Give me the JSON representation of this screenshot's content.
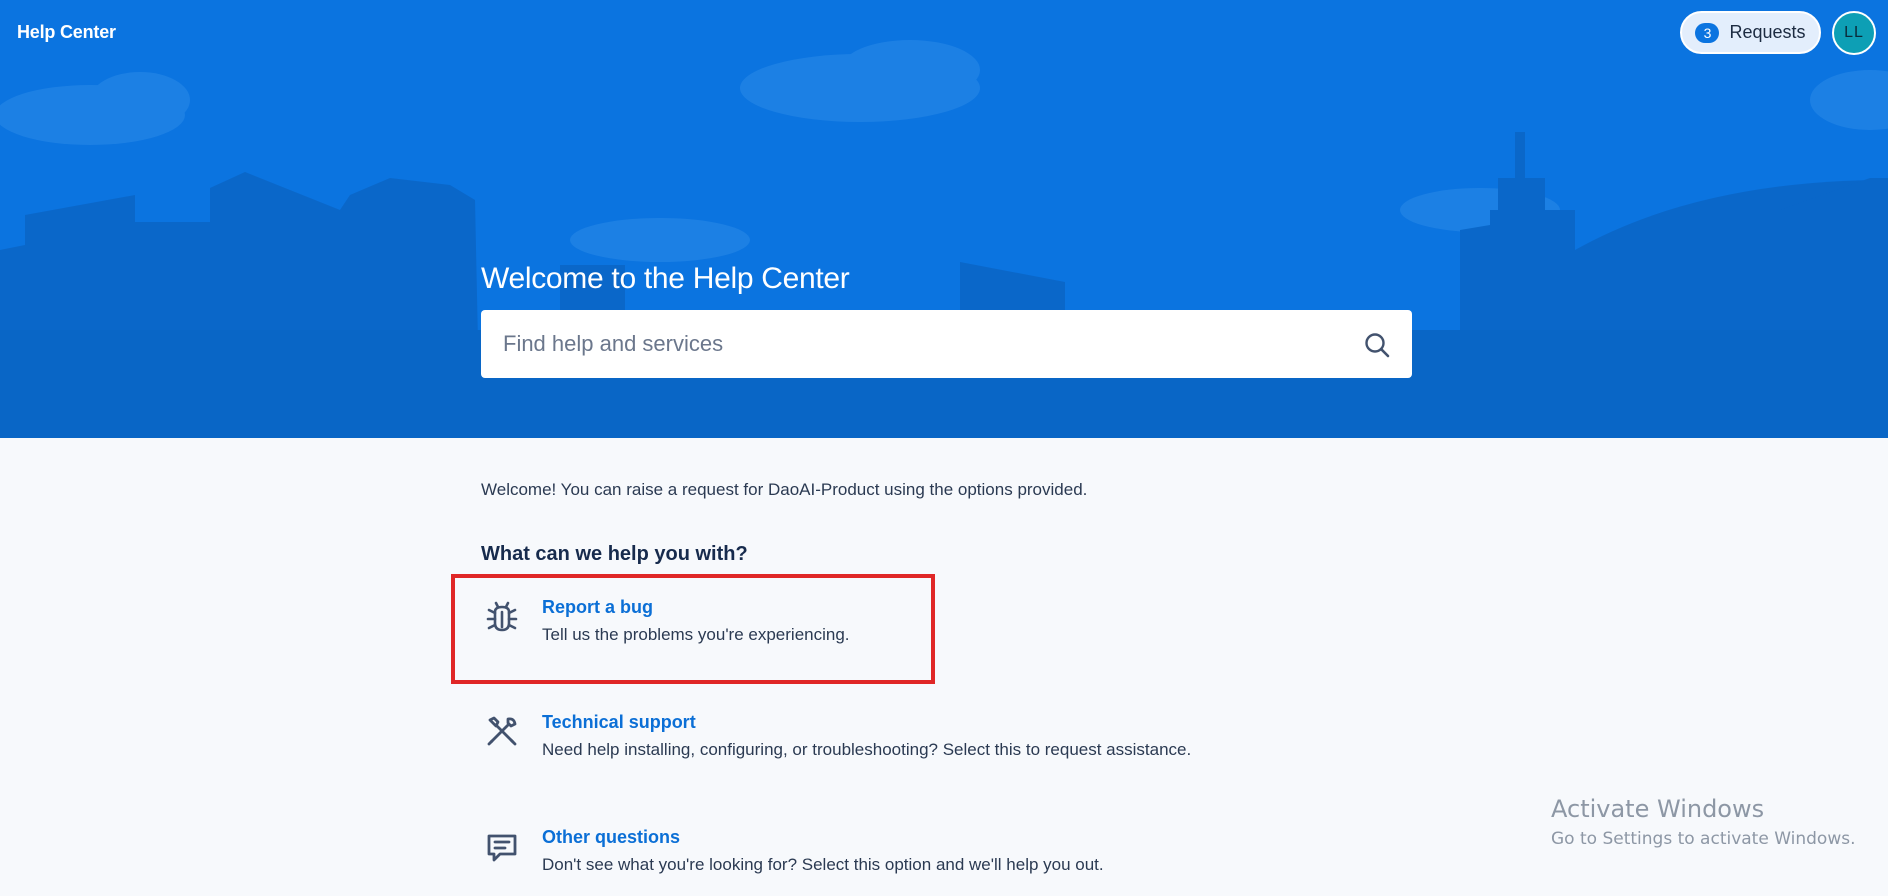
{
  "header": {
    "brand": "Help Center",
    "requests_count": "3",
    "requests_label": "Requests",
    "avatar_initials": "LL"
  },
  "hero": {
    "title": "Welcome to the Help Center",
    "search_placeholder": "Find help and services",
    "search_value": ""
  },
  "main": {
    "intro": "Welcome! You can raise a request for DaoAI-Product using the options provided.",
    "heading": "What can we help you with?",
    "options": [
      {
        "title": "Report a bug",
        "description": "Tell us the problems you're experiencing.",
        "icon": "bug-icon",
        "highlighted": true
      },
      {
        "title": "Technical support",
        "description": "Need help installing, configuring, or troubleshooting? Select this to request assistance.",
        "icon": "tools-icon",
        "highlighted": false
      },
      {
        "title": "Other questions",
        "description": "Don't see what you're looking for? Select this option and we'll help you out.",
        "icon": "comment-icon",
        "highlighted": false
      }
    ]
  },
  "watermark": {
    "title": "Activate Windows",
    "subtitle": "Go to Settings to activate Windows."
  },
  "colors": {
    "hero_background": "#0b74e0",
    "link": "#0b6fd6",
    "highlight_border": "#e02727",
    "page_background": "#f7f9fc"
  }
}
